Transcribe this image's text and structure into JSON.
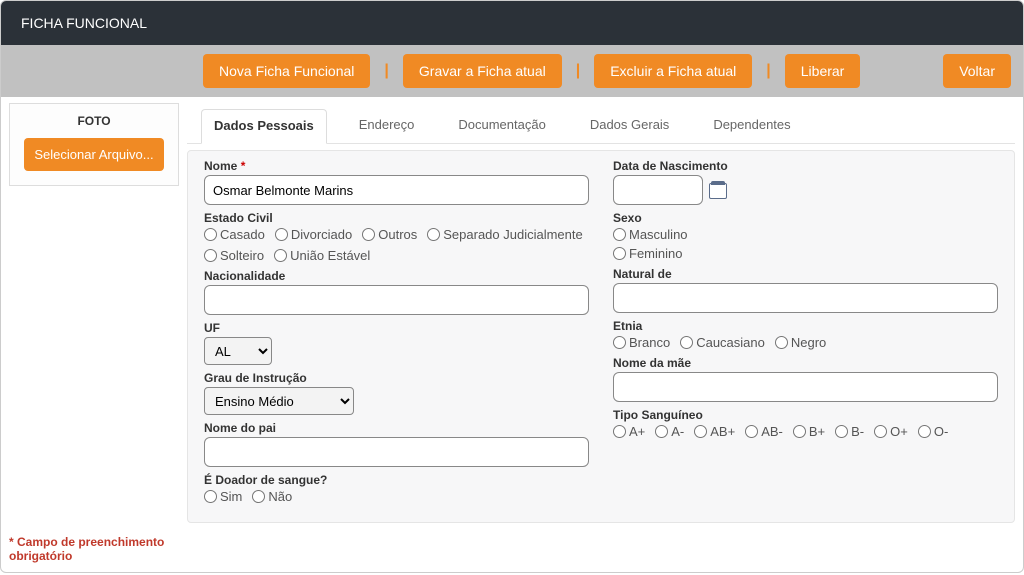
{
  "header": {
    "title": "FICHA FUNCIONAL"
  },
  "topbar": {
    "nova": "Nova Ficha Funcional",
    "gravar": "Gravar a Ficha atual",
    "excluir": "Excluir a Ficha atual",
    "liberar": "Liberar",
    "voltar": "Voltar"
  },
  "sidebar": {
    "foto": "FOTO",
    "selecionar": "Selecionar Arquivo..."
  },
  "tabs": {
    "pessoais": "Dados Pessoais",
    "endereco": "Endereço",
    "documentacao": "Documentação",
    "gerais": "Dados Gerais",
    "dependentes": "Dependentes"
  },
  "form": {
    "nome_label": "Nome ",
    "nome_value": "Osmar Belmonte Marins",
    "nascimento_label": "Data de Nascimento",
    "nascimento_value": "",
    "estado_civil_label": "Estado Civil",
    "estado_opts": {
      "casado": "Casado",
      "divorciado": "Divorciado",
      "outros": "Outros",
      "separado": "Separado Judicialmente",
      "solteiro": "Solteiro",
      "uniao": "União Estável"
    },
    "sexo_label": "Sexo",
    "sexo_opts": {
      "m": "Masculino",
      "f": "Feminino"
    },
    "nacionalidade_label": "Nacionalidade",
    "nacionalidade_value": "",
    "natural_label": "Natural de",
    "natural_value": "",
    "uf_label": "UF",
    "uf_value": "AL",
    "etnia_label": "Etnia",
    "etnia_opts": {
      "branco": "Branco",
      "caucasiano": "Caucasiano",
      "negro": "Negro"
    },
    "grau_label": "Grau de Instrução",
    "grau_value": "Ensino Médio",
    "mae_label": "Nome da mãe",
    "mae_value": "",
    "pai_label": "Nome do pai",
    "pai_value": "",
    "sang_label": "Tipo Sanguíneo",
    "sang_opts": {
      "ap": "A+",
      "am": "A-",
      "abp": "AB+",
      "abm": "AB-",
      "bp": "B+",
      "bm": "B-",
      "op": "O+",
      "om": "O-"
    },
    "doador_label": "É Doador de sangue?",
    "doador_opts": {
      "sim": "Sim",
      "nao": "Não"
    }
  },
  "footer": {
    "note1": "* Campo de preenchimento",
    "note2": "obrigatório"
  },
  "req": "*"
}
